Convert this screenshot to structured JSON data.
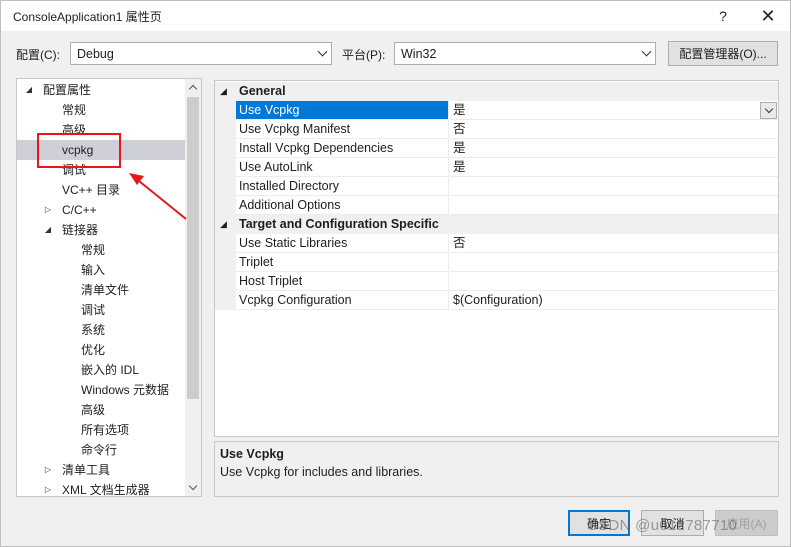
{
  "window": {
    "title": "ConsoleApplication1 属性页",
    "help_glyph": "?",
    "close_glyph": "✕"
  },
  "config_bar": {
    "config_label": "配置(C):",
    "config_value": "Debug",
    "platform_label": "平台(P):",
    "platform_value": "Win32",
    "manager_button": "配置管理器(O)..."
  },
  "tree": {
    "items": [
      {
        "label": "配置属性",
        "expander": "◢",
        "selected": false
      },
      {
        "label": "常规",
        "expander": "",
        "selected": false
      },
      {
        "label": "高级",
        "expander": "",
        "selected": false
      },
      {
        "label": "vcpkg",
        "expander": "",
        "selected": true
      },
      {
        "label": "调试",
        "expander": "",
        "selected": false
      },
      {
        "label": "VC++ 目录",
        "expander": "",
        "selected": false
      },
      {
        "label": "C/C++",
        "expander": "▷",
        "selected": false
      },
      {
        "label": "链接器",
        "expander": "◢",
        "selected": false
      },
      {
        "label": "常规",
        "expander": "",
        "selected": false
      },
      {
        "label": "输入",
        "expander": "",
        "selected": false
      },
      {
        "label": "清单文件",
        "expander": "",
        "selected": false
      },
      {
        "label": "调试",
        "expander": "",
        "selected": false
      },
      {
        "label": "系统",
        "expander": "",
        "selected": false
      },
      {
        "label": "优化",
        "expander": "",
        "selected": false
      },
      {
        "label": "嵌入的 IDL",
        "expander": "",
        "selected": false
      },
      {
        "label": "Windows 元数据",
        "expander": "",
        "selected": false
      },
      {
        "label": "高级",
        "expander": "",
        "selected": false
      },
      {
        "label": "所有选项",
        "expander": "",
        "selected": false
      },
      {
        "label": "命令行",
        "expander": "",
        "selected": false
      },
      {
        "label": "清单工具",
        "expander": "▷",
        "selected": false
      },
      {
        "label": "XML 文档生成器",
        "expander": "▷",
        "selected": false
      }
    ]
  },
  "grid": {
    "categories": [
      {
        "name": "General",
        "expander": "◢",
        "props": [
          {
            "name": "Use Vcpkg",
            "value": "是",
            "selected": true
          },
          {
            "name": "Use Vcpkg Manifest",
            "value": "否",
            "selected": false
          },
          {
            "name": "Install Vcpkg Dependencies",
            "value": "是",
            "selected": false
          },
          {
            "name": "Use AutoLink",
            "value": "是",
            "selected": false
          },
          {
            "name": "Installed Directory",
            "value": "",
            "selected": false
          },
          {
            "name": "Additional Options",
            "value": "",
            "selected": false
          }
        ]
      },
      {
        "name": "Target and Configuration Specific",
        "expander": "◢",
        "props": [
          {
            "name": "Use Static Libraries",
            "value": "否",
            "selected": false
          },
          {
            "name": "Triplet",
            "value": "",
            "selected": false
          },
          {
            "name": "Host Triplet",
            "value": "",
            "selected": false
          },
          {
            "name": "Vcpkg Configuration",
            "value": "$(Configuration)",
            "selected": false
          }
        ]
      }
    ]
  },
  "description": {
    "title": "Use Vcpkg",
    "text": "Use Vcpkg for includes and libraries."
  },
  "buttons": {
    "ok": "确定",
    "cancel": "取消",
    "apply": "应用(A)"
  },
  "watermark": "CSDN @u012787710",
  "colors": {
    "selection": "#0078d7",
    "annotation_red": "#e8171b",
    "tree_selected": "#cfcfd8"
  }
}
